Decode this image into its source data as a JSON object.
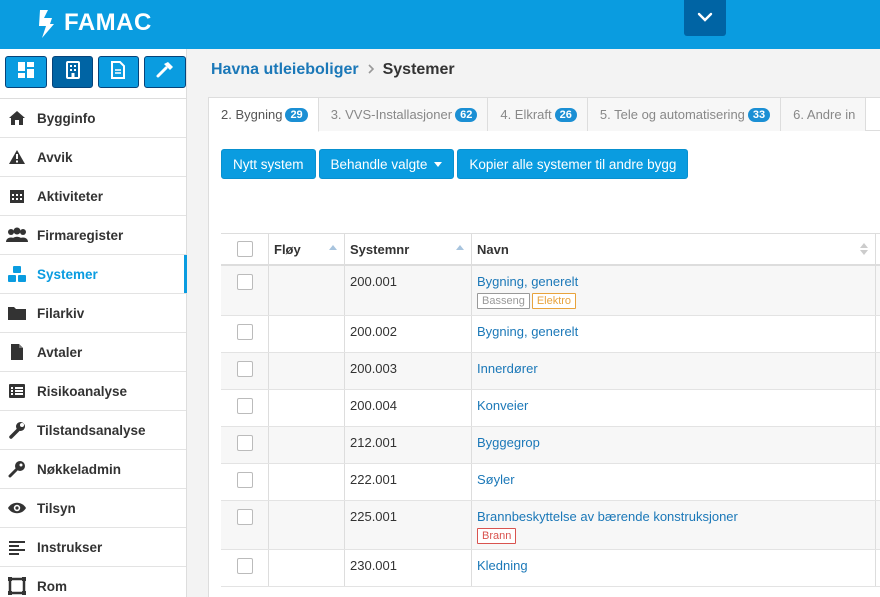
{
  "app": {
    "logo_text": "FAMAC"
  },
  "colors": {
    "brand": "#0a9ce0",
    "dark": "#0064a4",
    "link": "#1b78b8"
  },
  "sidebar": {
    "tools": [
      {
        "icon": "dashboard-icon"
      },
      {
        "icon": "building-icon"
      },
      {
        "icon": "document-icon"
      },
      {
        "icon": "hammer-icon"
      }
    ],
    "items": [
      {
        "label": "Bygginfo",
        "icon": "home-icon"
      },
      {
        "label": "Avvik",
        "icon": "warning-icon"
      },
      {
        "label": "Aktiviteter",
        "icon": "calendar-icon"
      },
      {
        "label": "Firmaregister",
        "icon": "people-icon"
      },
      {
        "label": "Systemer",
        "icon": "cubes-icon",
        "active": true
      },
      {
        "label": "Filarkiv",
        "icon": "folder-icon"
      },
      {
        "label": "Avtaler",
        "icon": "file-icon"
      },
      {
        "label": "Risikoanalyse",
        "icon": "list-icon"
      },
      {
        "label": "Tilstandsanalyse",
        "icon": "wrench-icon"
      },
      {
        "label": "Nøkkeladmin",
        "icon": "key-icon"
      },
      {
        "label": "Tilsyn",
        "icon": "eye-icon"
      },
      {
        "label": "Instrukser",
        "icon": "align-left-icon"
      },
      {
        "label": "Rom",
        "icon": "room-icon"
      }
    ]
  },
  "breadcrumb": {
    "parent": "Havna utleieboliger",
    "current": "Systemer"
  },
  "tabs": [
    {
      "label": "2. Bygning",
      "count": "29",
      "active": true
    },
    {
      "label": "3. VVS-Installasjoner",
      "count": "62"
    },
    {
      "label": "4. Elkraft",
      "count": "26"
    },
    {
      "label": "5. Tele og automatisering",
      "count": "33"
    },
    {
      "label": "6. Andre in"
    }
  ],
  "actions": {
    "new_system": "Nytt system",
    "handle_selected": "Behandle valgte",
    "copy_all": "Kopier alle systemer til andre bygg"
  },
  "table": {
    "headers": {
      "wing": "Fløy",
      "system_no": "Systemnr",
      "name": "Navn"
    },
    "rows": [
      {
        "wing": "",
        "system_no": "200.001",
        "name": "Bygning, generelt",
        "tags": [
          {
            "label": "Basseng",
            "color": "#999999"
          },
          {
            "label": "Elektro",
            "color": "#e8a33c"
          }
        ]
      },
      {
        "wing": "",
        "system_no": "200.002",
        "name": "Bygning, generelt",
        "tags": []
      },
      {
        "wing": "",
        "system_no": "200.003",
        "name": "Innerdører",
        "tags": []
      },
      {
        "wing": "",
        "system_no": "200.004",
        "name": "Konveier",
        "tags": []
      },
      {
        "wing": "",
        "system_no": "212.001",
        "name": "Byggegrop",
        "tags": []
      },
      {
        "wing": "",
        "system_no": "222.001",
        "name": "Søyler",
        "tags": []
      },
      {
        "wing": "",
        "system_no": "225.001",
        "name": "Brannbeskyttelse av bærende konstruksjoner",
        "tags": [
          {
            "label": "Brann",
            "color": "#d9534f"
          }
        ]
      },
      {
        "wing": "",
        "system_no": "230.001",
        "name": "Kledning",
        "tags": []
      }
    ]
  }
}
